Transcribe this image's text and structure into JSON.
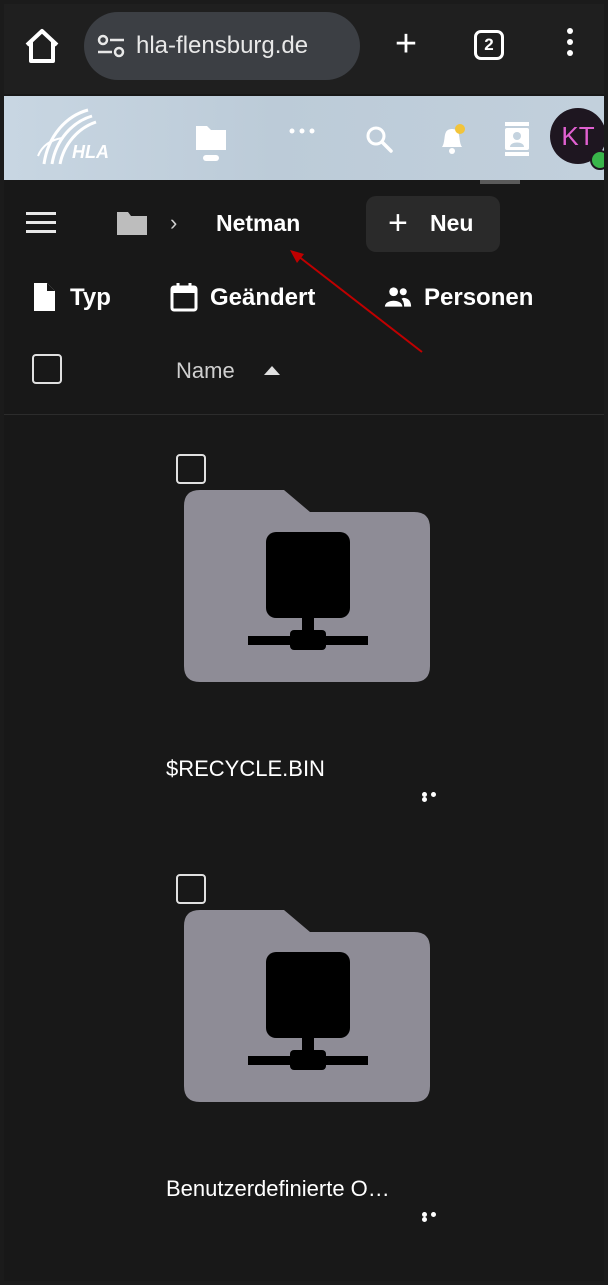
{
  "browser": {
    "url": "hla-flensburg.de",
    "tab_count": "2",
    "new_tab_symbol": "+"
  },
  "header": {
    "avatar_initials": "KT",
    "icons": [
      "files-icon",
      "more-apps-icon",
      "search-icon",
      "notifications-icon",
      "contacts-icon"
    ]
  },
  "breadcrumb": {
    "current": "Netman",
    "separator": "›"
  },
  "toolbar": {
    "new_symbol": "+",
    "new_label": "Neu"
  },
  "filters": [
    {
      "label": "Typ",
      "icon": "file-icon"
    },
    {
      "label": "Geändert",
      "icon": "calendar-icon"
    },
    {
      "label": "Personen",
      "icon": "people-icon"
    }
  ],
  "list": {
    "column_name": "Name",
    "sort": "ascending",
    "items": [
      {
        "name": "$RECYCLE.BIN",
        "icon": "network-folder-icon"
      },
      {
        "name": "Benutzerdefinierte O…",
        "icon": "network-folder-icon"
      }
    ]
  },
  "colors": {
    "background": "#181818",
    "header_bar": "#c4d3df",
    "folder": "#8e8c96",
    "annotation_arrow": "#c00000",
    "avatar_text": "#e060d0",
    "status_online": "#39b54a"
  }
}
